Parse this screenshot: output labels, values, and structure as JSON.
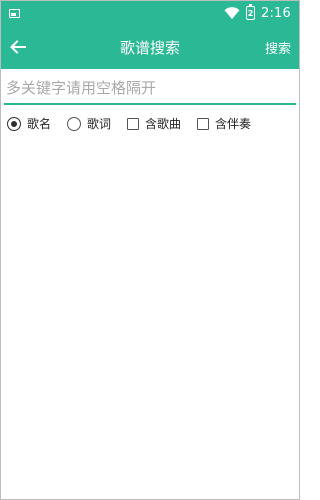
{
  "status_bar": {
    "time": "2:16",
    "battery_level": "2"
  },
  "toolbar": {
    "title": "歌谱搜索",
    "search_label": "搜索"
  },
  "search": {
    "placeholder": "多关键字请用空格隔开",
    "value": ""
  },
  "options": [
    {
      "label": "歌名",
      "type": "radio",
      "checked": true
    },
    {
      "label": "歌词",
      "type": "radio",
      "checked": false
    },
    {
      "label": "含歌曲",
      "type": "checkbox",
      "checked": false
    },
    {
      "label": "含伴奏",
      "type": "checkbox",
      "checked": false
    }
  ],
  "colors": {
    "accent": "#2bb894"
  },
  "icons": {
    "status_left": "gallery-icon",
    "wifi": "wifi-icon",
    "battery": "battery-icon",
    "back": "back-arrow-icon"
  }
}
